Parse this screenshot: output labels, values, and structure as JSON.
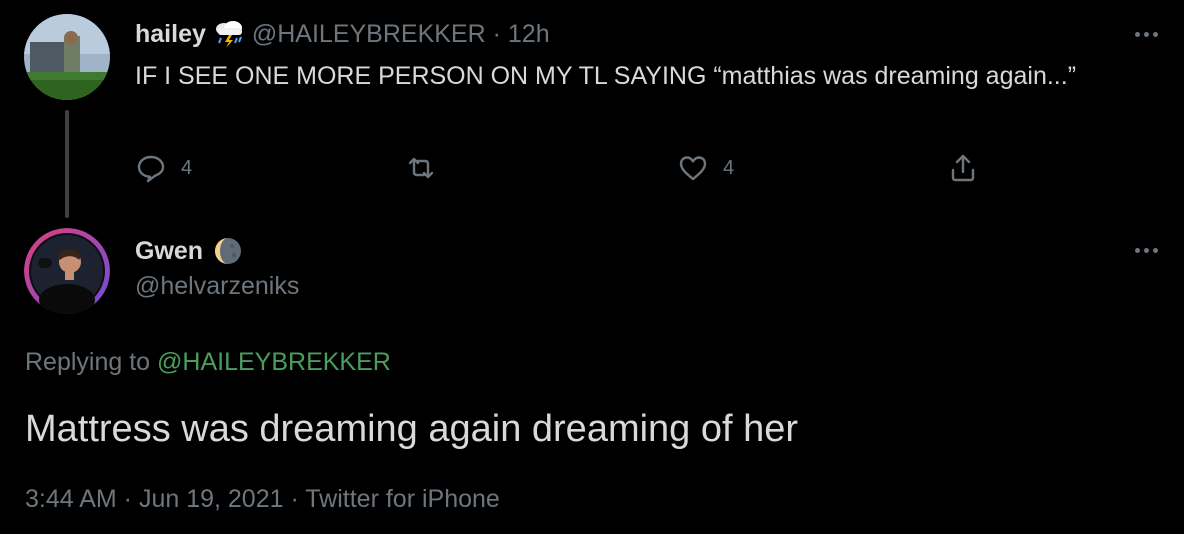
{
  "parent_tweet": {
    "display_name": "hailey",
    "name_emoji": "cloud-lightning-rain-icon",
    "handle_time": "@HAILEYBREKKER · 12h",
    "text": "IF I SEE ONE MORE PERSON ON MY TL SAYING “matthias was dreaming again...”",
    "reply_count": "4",
    "retweet_count": "",
    "like_count": "4"
  },
  "reply_tweet": {
    "display_name": "Gwen",
    "name_emoji": "moon-icon",
    "handle": "@helvarzeniks",
    "replying_prefix": "Replying to",
    "replying_handle": "@HAILEYBREKKER",
    "text": "Mattress was dreaming again dreaming of her",
    "meta": "3:44 AM · Jun 19, 2021 · Twitter for iPhone"
  },
  "colors": {
    "background": "#000000",
    "text": "#d9d9d9",
    "secondary": "#6e767d",
    "mention": "#4a9e5c",
    "thread_line": "#3d4247"
  }
}
